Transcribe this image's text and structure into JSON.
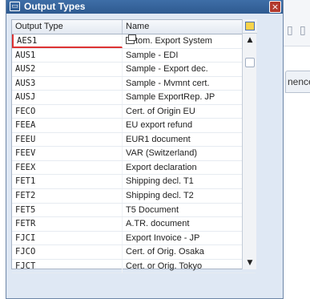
{
  "dialog": {
    "title": "Output Types",
    "close_symbol": "×"
  },
  "table": {
    "headers": [
      "Output Type",
      "Name"
    ],
    "rows": [
      {
        "code": "AES1",
        "name": "tom. Export System"
      },
      {
        "code": "AUS1",
        "name": "Sample - EDI"
      },
      {
        "code": "AUS2",
        "name": "Sample - Export dec."
      },
      {
        "code": "AUS3",
        "name": "Sample - Mvmnt cert."
      },
      {
        "code": "AUSJ",
        "name": "Sample ExportRep. JP"
      },
      {
        "code": "FECO",
        "name": "Cert. of Origin EU"
      },
      {
        "code": "FEEA",
        "name": "EU export refund"
      },
      {
        "code": "FEEU",
        "name": "EUR1 document"
      },
      {
        "code": "FEEV",
        "name": "VAR (Switzerland)"
      },
      {
        "code": "FEEX",
        "name": "Export declaration"
      },
      {
        "code": "FET1",
        "name": "Shipping decl. T1"
      },
      {
        "code": "FET2",
        "name": "Shipping decl. T2"
      },
      {
        "code": "FET5",
        "name": "T5 Document"
      },
      {
        "code": "FETR",
        "name": "A.TR. document"
      },
      {
        "code": "FJCI",
        "name": "Export Invoice - JP"
      },
      {
        "code": "FJCO",
        "name": "Cert. of Orig. Osaka"
      },
      {
        "code": "FJCT",
        "name": "Cert. or Orig. Tokyo"
      }
    ]
  },
  "background": {
    "tab_label": "nences",
    "colors": {
      "titlebar": "#2e5a90",
      "dialog_bg": "#dfe8f4",
      "close": "#b23a2e"
    }
  },
  "icons": [
    "output-types-icon",
    "close-icon",
    "column-layout-icon",
    "scroll-up-icon",
    "scroll-down-icon",
    "copy-icon"
  ]
}
